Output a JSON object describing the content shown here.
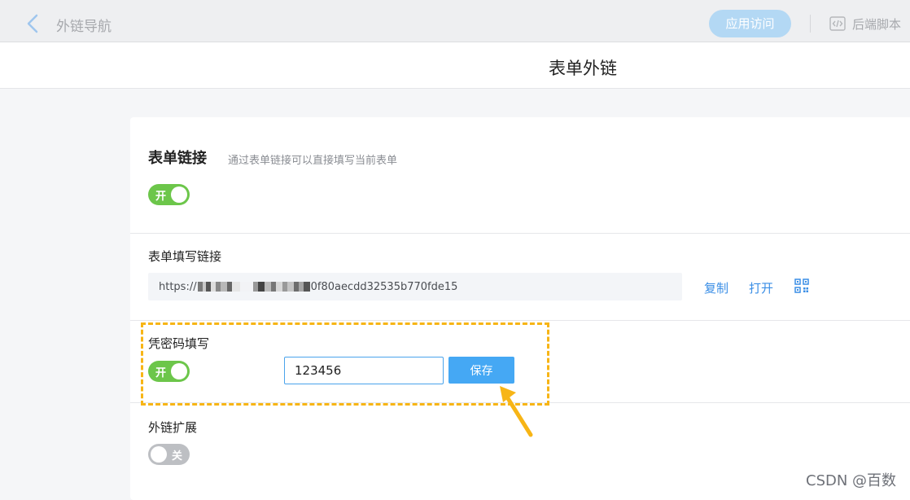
{
  "nav": {
    "title": "外链导航",
    "app_visit_label": "应用访问",
    "backend_script_label": "后端脚本"
  },
  "page_title": "表单外链",
  "form_link_section": {
    "heading": "表单链接",
    "description": "通过表单链接可以直接填写当前表单",
    "toggle_label": "开",
    "toggle_on": true
  },
  "fill_link": {
    "label": "表单填写链接",
    "url_prefix": "https://",
    "url_suffix": "0f80aecdd32535b770fde15",
    "copy_label": "复制",
    "open_label": "打开",
    "qr_icon": "qrcode-icon"
  },
  "password_fill": {
    "label": "凭密码填写",
    "toggle_label": "开",
    "toggle_on": true,
    "password_value": "123456",
    "save_label": "保存"
  },
  "extension": {
    "label": "外链扩展",
    "toggle_label": "关",
    "toggle_on": false
  },
  "watermark": "CSDN @百数",
  "colors": {
    "accent_blue": "#3a8ee6",
    "toggle_on": "#6cc64a",
    "toggle_off": "#bdbfc3",
    "highlight": "#f7b516",
    "save_button": "#45a8f4"
  }
}
